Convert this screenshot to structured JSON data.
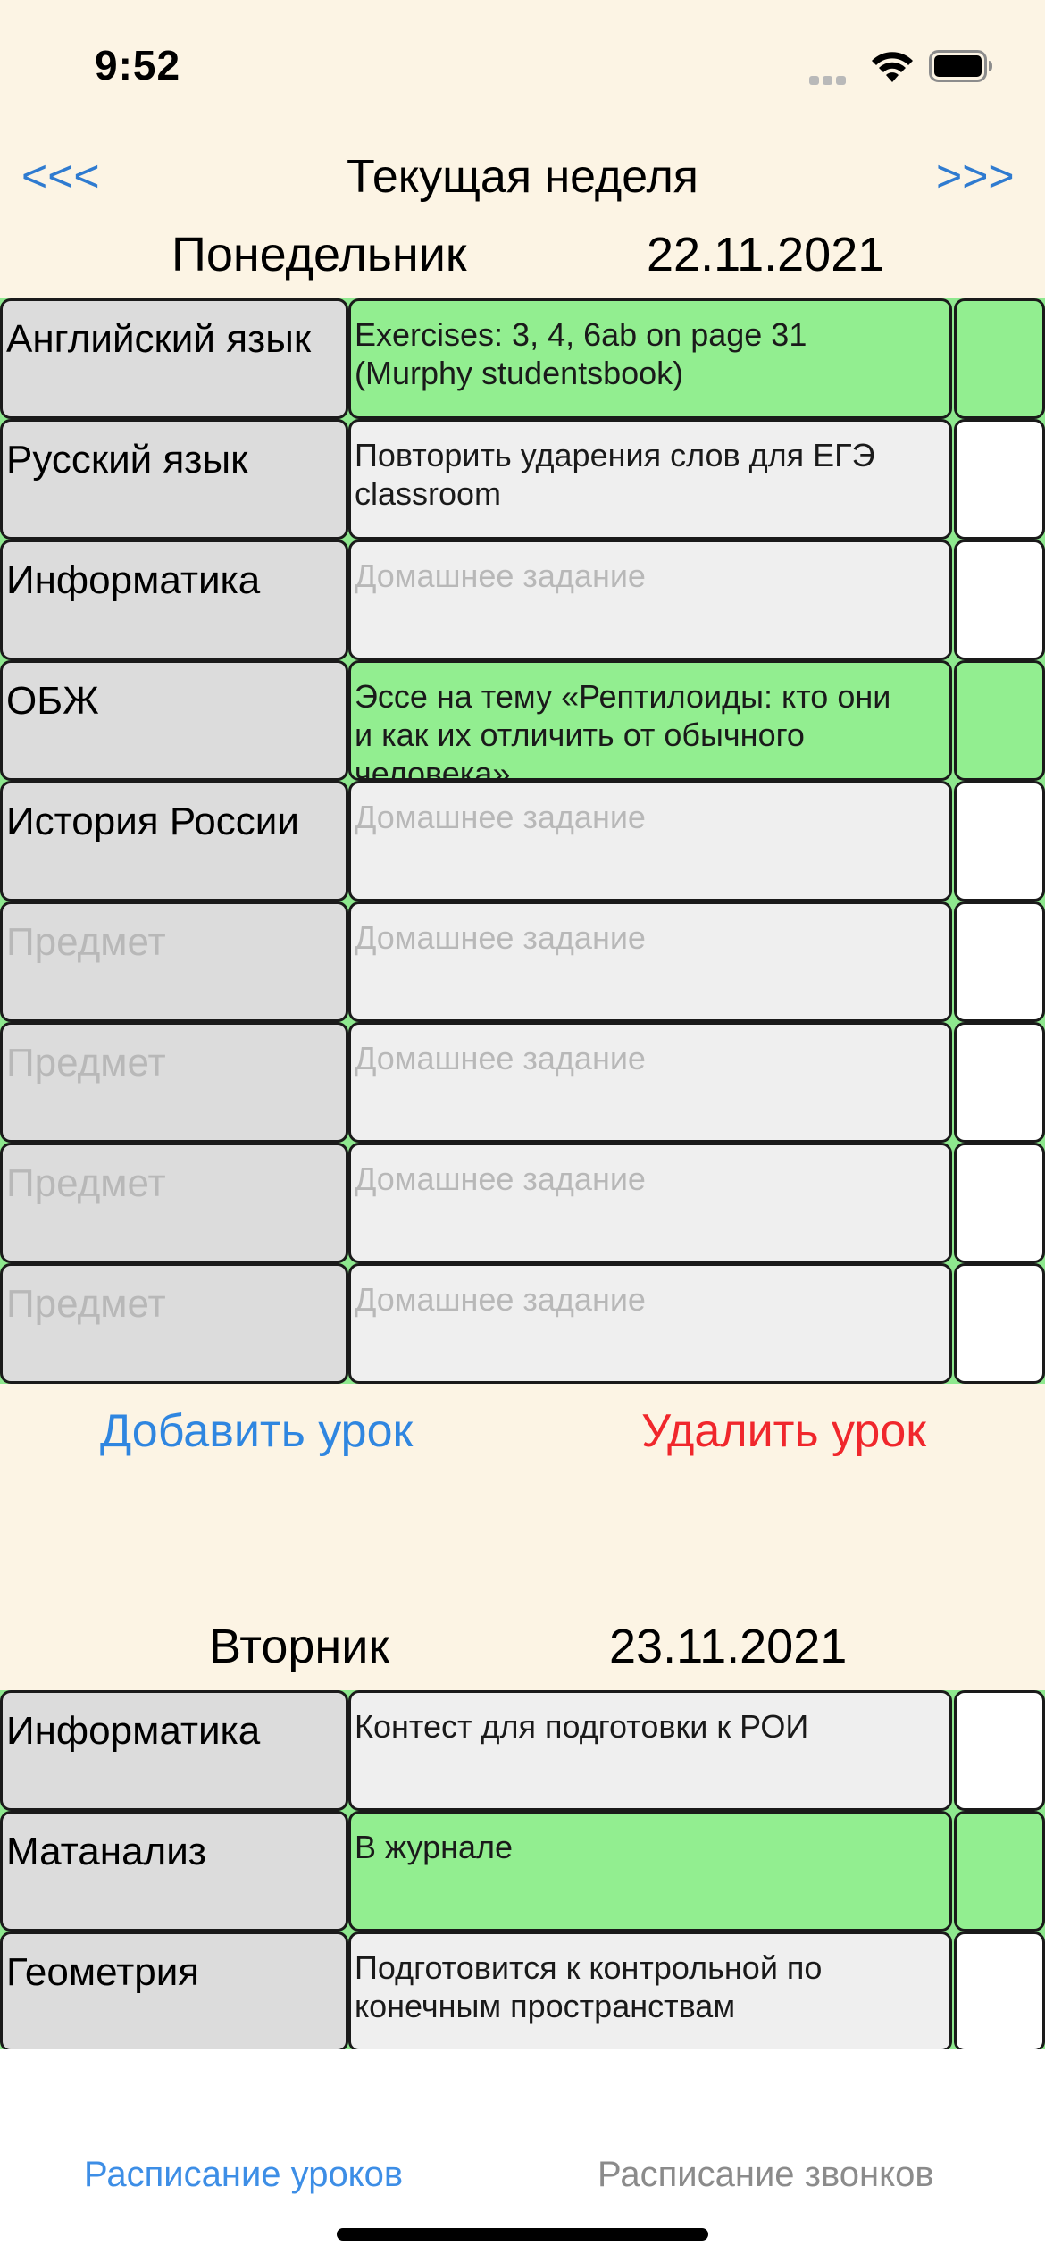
{
  "status_bar": {
    "time": "9:52"
  },
  "header": {
    "prev_label": "<<<",
    "title": "Текущая неделя",
    "next_label": ">>>"
  },
  "days": [
    {
      "name": "Понедельник",
      "date": "22.11.2021",
      "lessons": [
        {
          "subject": "Английский язык",
          "homework_lines": [
            "Exercises: 3, 4, 6ab on page 31",
            "(Murphy studentsbook)"
          ],
          "done": true
        },
        {
          "subject": "Русский язык",
          "homework_lines": [
            "Повторить ударения слов для ЕГЭ",
            "classroom"
          ],
          "done": false
        },
        {
          "subject": "Информатика",
          "homework_placeholder": "Домашнее задание",
          "done": false
        },
        {
          "subject": "ОБЖ",
          "homework_lines": [
            "Эссе на тему «Рептилоиды: кто они",
            "и как их отличить от обычного",
            "человека»"
          ],
          "done": true
        },
        {
          "subject": "История России",
          "homework_placeholder": "Домашнее задание",
          "done": false
        },
        {
          "subject_placeholder": "Предмет",
          "homework_placeholder": "Домашнее задание",
          "done": false
        },
        {
          "subject_placeholder": "Предмет",
          "homework_placeholder": "Домашнее задание",
          "done": false
        },
        {
          "subject_placeholder": "Предмет",
          "homework_placeholder": "Домашнее задание",
          "done": false
        },
        {
          "subject_placeholder": "Предмет",
          "homework_placeholder": "Домашнее задание",
          "done": false
        }
      ]
    },
    {
      "name": "Вторник",
      "date": "23.11.2021",
      "lessons": [
        {
          "subject": "Информатика",
          "homework_lines": [
            "Контест для подготовки к РОИ"
          ],
          "done": false
        },
        {
          "subject": "Матанализ",
          "homework_lines": [
            "В журнале"
          ],
          "done": true
        },
        {
          "subject": "Геометрия",
          "homework_lines": [
            "Подготовится к контрольной по",
            "конечным пространствам"
          ],
          "done": false
        }
      ]
    }
  ],
  "actions": {
    "add_lesson": "Добавить урок",
    "delete_lesson": "Удалить урок"
  },
  "tab_bar": {
    "tabs": [
      {
        "label": "Расписание уроков",
        "active": true
      },
      {
        "label": "Расписание звонков",
        "active": false
      }
    ]
  }
}
